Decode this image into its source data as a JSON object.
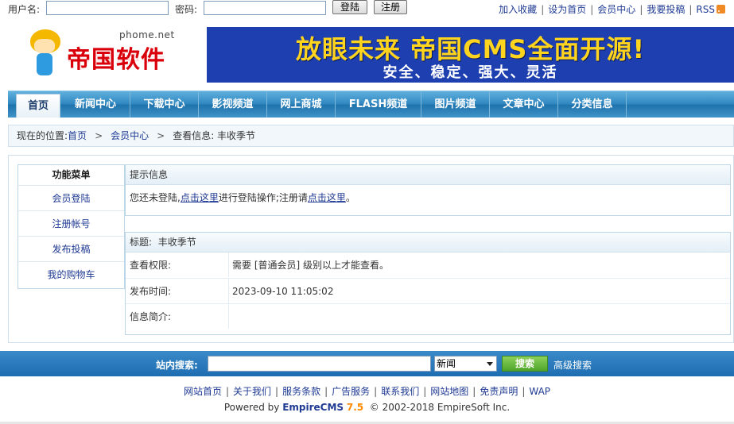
{
  "topbar": {
    "username_label": "用户名:",
    "password_label": "密码:",
    "login_button": "登陆",
    "register_button": "注册",
    "links": [
      "加入收藏",
      "设为首页",
      "会员中心",
      "我要投稿",
      "RSS"
    ]
  },
  "header": {
    "site_domain": "phome.net",
    "brand": "帝国软件",
    "banner_line1": "放眼未来 帝国CMS全面开源!",
    "banner_line2": "安全、稳定、强大、灵活"
  },
  "nav": {
    "items": [
      "首页",
      "新闻中心",
      "下载中心",
      "影视频道",
      "网上商城",
      "FLASH频道",
      "图片频道",
      "文章中心",
      "分类信息"
    ]
  },
  "breadcrumb": {
    "prefix": "现在的位置:",
    "home": "首页",
    "member": "会员中心",
    "current": "查看信息: 丰收季节"
  },
  "sidebar": {
    "title": "功能菜单",
    "items": [
      "会员登陆",
      "注册帐号",
      "发布投稿",
      "我的购物车"
    ]
  },
  "notice": {
    "title": "提示信息",
    "text_before": "您还未登陆,",
    "link1": "点击这里",
    "text_middle": "进行登陆操作;注册请",
    "link2": "点击这里",
    "text_after": "。"
  },
  "info": {
    "title_label": "标题:",
    "title_value": "丰收季节",
    "rows": [
      {
        "key": "查看权限:",
        "value": "需要 [普通会员] 级别以上才能查看。"
      },
      {
        "key": "发布时间:",
        "value": "2023-09-10 11:05:02"
      },
      {
        "key": "信息简介:",
        "value": ""
      }
    ]
  },
  "search": {
    "label": "站内搜索:",
    "keyword": "",
    "category": "新闻",
    "button": "搜索",
    "advanced": "高级搜索"
  },
  "footer": {
    "links": [
      "网站首页",
      "关于我们",
      "服务条款",
      "广告服务",
      "联系我们",
      "网站地图",
      "免责声明",
      "WAP"
    ],
    "powered_by": "Powered by",
    "product": "EmpireCMS",
    "version": "7.5",
    "copyright": "© 2002-2018 EmpireSoft Inc."
  }
}
